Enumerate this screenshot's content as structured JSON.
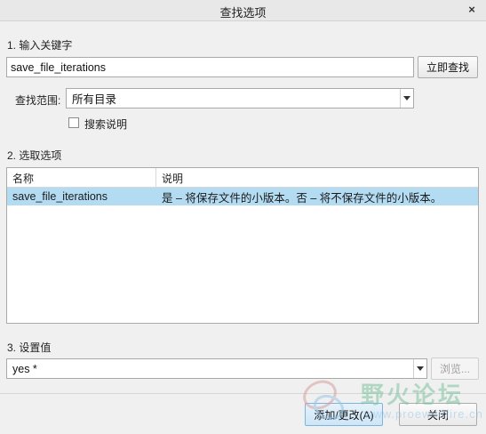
{
  "dialog": {
    "title": "查找选项",
    "close_label": "×"
  },
  "keyword": {
    "section_label": "1.  输入关键字",
    "value": "save_file_iterations",
    "search_now_label": "立即查找"
  },
  "scope": {
    "label": "查找范围:",
    "selected": "所有目录",
    "search_description_label": "搜索说明",
    "search_description_checked": false
  },
  "options": {
    "section_label": "2.  选取选项",
    "columns": [
      "名称",
      "说明"
    ],
    "rows": [
      {
        "name": "save_file_iterations",
        "description": "是 – 将保存文件的小版本。否 – 将不保存文件的小版本。",
        "selected": true
      }
    ]
  },
  "value_section": {
    "section_label": "3.  设置值",
    "selected": "yes *",
    "browse_label": "浏览..."
  },
  "footer": {
    "add_change_label": "添加/更改(A)",
    "close_label": "关闭"
  },
  "watermark": {
    "text": "野火论坛",
    "url": "www.proewildfire.cn"
  },
  "colors": {
    "selection": "#b3dcf3",
    "background": "#f0f0f0"
  }
}
